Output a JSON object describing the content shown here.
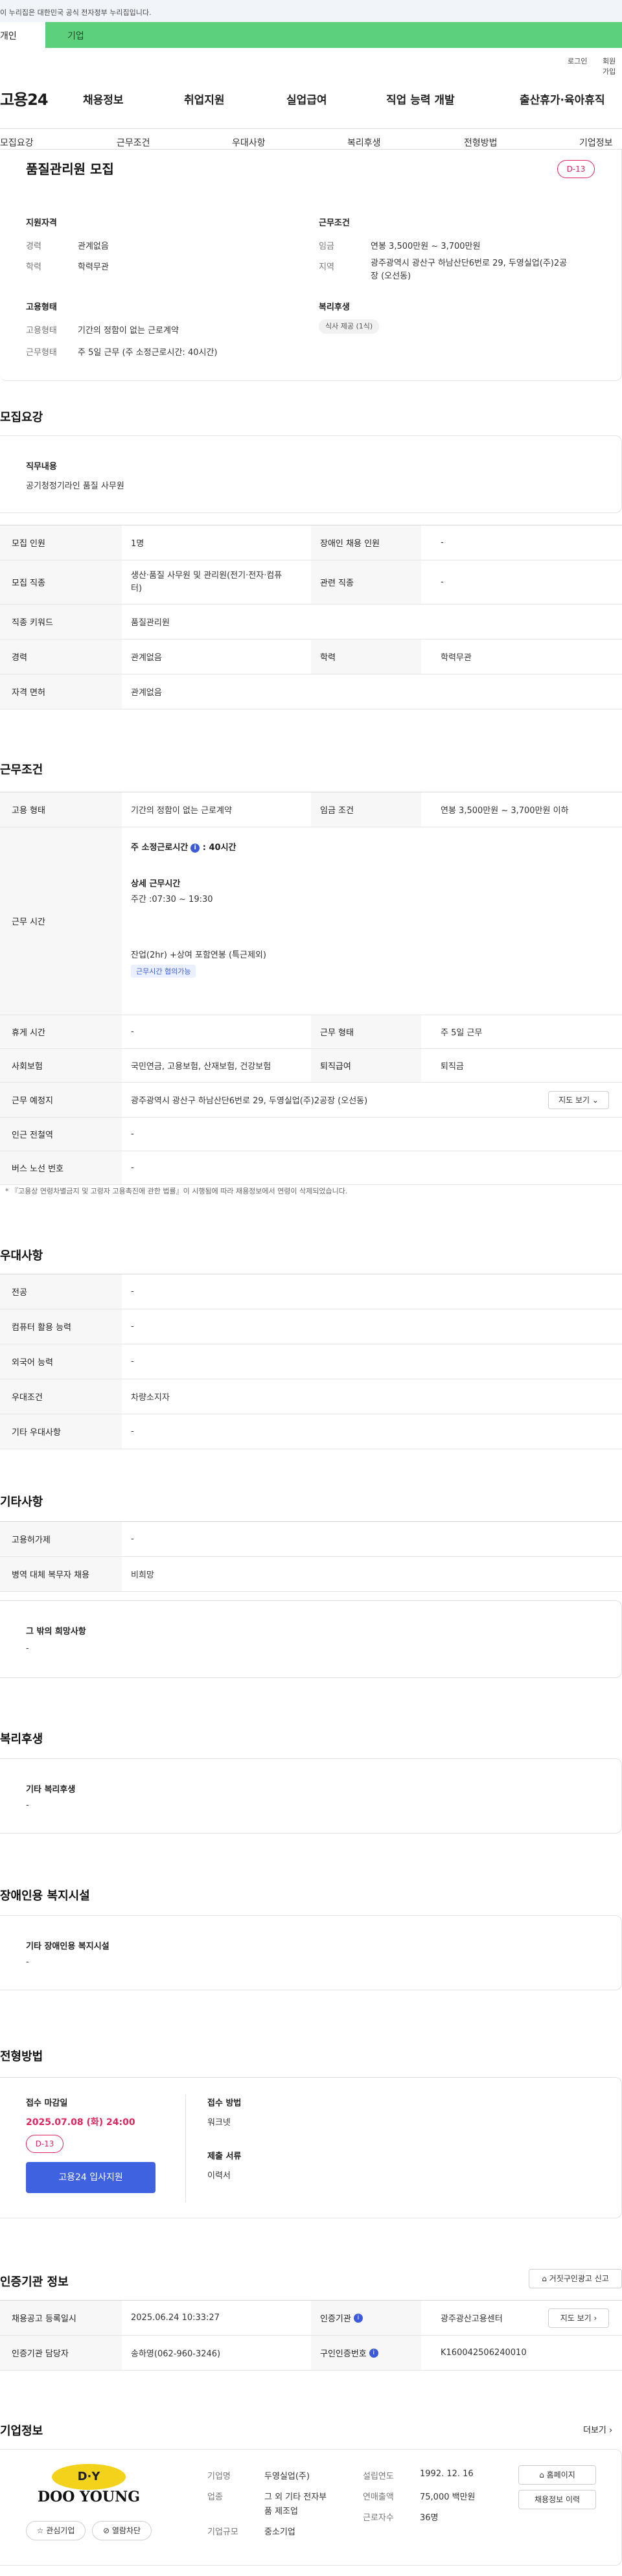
{
  "gov_banner": "이 누리집은 대한민국 공식 전자정부 누리집입니다.",
  "user_tabs": [
    "개인",
    "기업"
  ],
  "util": [
    "로그인",
    "회원가입"
  ],
  "logo": "고용24",
  "gnb": [
    "채용정보",
    "취업지원",
    "실업급여",
    "직업 능력 개발",
    "출산휴가·육아휴직"
  ],
  "tabs": [
    "모집요강",
    "근무조건",
    "우대사항",
    "복리후생",
    "전형방법",
    "기업정보"
  ],
  "job": {
    "title": "품질관리원 모집",
    "dday": "D-13",
    "req_title": "지원자격",
    "career_k": "경력",
    "career_v": "관계없음",
    "edu_k": "학력",
    "edu_v": "학력무관",
    "cond_title": "근무조건",
    "wage_k": "임금",
    "wage_v": "연봉 3,500만원 ~ 3,700만원",
    "region_k": "지역",
    "region_v1": "광주광역시 광산구 하남산단6번로 29, 두영실업(주)2공",
    "region_v2": "장 (오선동)",
    "emp_title": "고용형태",
    "emp_k": "고용형태",
    "emp_v": "기간의 정함이 없는 근로계약",
    "work_k": "근무형태",
    "work_v": "주 5일 근무 (주 소정근로시간: 40시간)",
    "welfare_title": "복리후생",
    "welfare_pill": "식사 제공 (1식)"
  },
  "recruit": {
    "title": "모집요강",
    "duty_title": "직무내용",
    "duty_text": "공기청정기라인 품질 사무원",
    "r1k": "모집 인원",
    "r1v": "1명",
    "r1k2": "장애인 채용 인원",
    "r1v2": "-",
    "r2k": "모집 직종",
    "r2v1": "생산·품질 사무원 및 관리원(전기·전자·컴퓨",
    "r2v2": "터)",
    "r2k2": "관련 직종",
    "r2v2b": "-",
    "r3k": "직종 키워드",
    "r3v": "품질관리원",
    "r4k": "경력",
    "r4v": "관계없음",
    "r4k2": "학력",
    "r4v2": "학력무관",
    "r5k": "자격 면허",
    "r5v": "관계없음"
  },
  "cond": {
    "title": "근무조건",
    "c1k": "고용 형태",
    "c1v": "기간의 정함이 없는 근로계약",
    "c1k2": "임금 조건",
    "c1v2": "연봉 3,500만원 ~ 3,700만원 이하",
    "c2k": "근무 시간",
    "hours_label": "주 소정근로시간",
    "hours_val": ": 40시간",
    "detail_label": "상세 근무시간",
    "detail_val": "주간 :07:30 ~ 19:30",
    "overtime": "잔업(2hr) +상여 포함연봉 (특근제외)",
    "tag": "근무시간 협의가능",
    "c3k": "휴게 시간",
    "c3v": "-",
    "c3k2": "근무 형태",
    "c3v2": "주 5일 근무",
    "c4k": "사회보험",
    "c4v": "국민연금, 고용보험, 산재보험, 건강보험",
    "c4k2": "퇴직급여",
    "c4v2": "퇴직금",
    "c5k": "근무 예정지",
    "c5v": "광주광역시 광산구 하남산단6번로 29, 두영실업(주)2공장 (오선동)",
    "map_btn": "지도 보기",
    "c6k": "인근 전철역",
    "c6v": "-",
    "c7k": "버스 노선 번호",
    "c7v": "-",
    "note": "* 『고용상 연령차별금지 및 고령자 고용촉진에 관한 법률』이 시행됨에 따라 채용정보에서 연령이 삭제되었습니다."
  },
  "pref": {
    "title": "우대사항",
    "p1k": "전공",
    "p1v": "-",
    "p2k": "컴퓨터 활용 능력",
    "p2v": "-",
    "p3k": "외국어 능력",
    "p3v": "-",
    "p4k": "우대조건",
    "p4v": "차량소지자",
    "p5k": "기타 우대사항",
    "p5v": "-"
  },
  "etc": {
    "title": "기타사항",
    "e1k": "고용허가제",
    "e1v": "-",
    "e2k": "병역 대체 복무자 채용",
    "e2v": "비희망",
    "wish_title": "그 밖의 희망사항",
    "wish_v": "-"
  },
  "welfare": {
    "title": "복리후생",
    "box_title": "기타 복리후생",
    "box_v": "-"
  },
  "disability": {
    "title": "장애인용 복지시설",
    "box_title": "기타 장애인용 복지시설",
    "box_v": "-"
  },
  "selection": {
    "title": "전형방법",
    "deadline_label": "접수 마감일",
    "deadline": "2025.07.08 (화) 24:00",
    "dday": "D-13",
    "apply_btn": "고용24 입사지원",
    "method_label": "접수 방법",
    "method_v": "워크넷",
    "docs_label": "제출 서류",
    "docs_v": "이력서"
  },
  "cert": {
    "title": "인증기관 정보",
    "report_btn": "거짓구인광고 신고",
    "k1": "채용공고 등록일시",
    "v1": "2025.06.24 10:33:27",
    "k2": "인증기관",
    "v2": "광주광산고용센터",
    "map_btn": "지도 보기",
    "k3": "인증기관 담당자",
    "v3": "송하영(062-960-3246)",
    "k4": "구인인증번호",
    "v4": "K160042506240010"
  },
  "company": {
    "title": "기업정보",
    "more": "더보기",
    "logo_top": "D·Y",
    "logo_name": "DOO YOUNG",
    "fav_btn": "관심기업",
    "block_btn": "열람차단",
    "name_k": "기업명",
    "name_v": "두영실업(주)",
    "ind_k": "업종",
    "ind_v1": "그 외 기타 전자부",
    "ind_v2": "품 제조업",
    "size_k": "기업규모",
    "size_v": "중소기업",
    "est_k": "설립연도",
    "est_v": "1992. 12. 16",
    "sales_k": "연매출액",
    "sales_v": "75,000 백만원",
    "emp_k": "근로자수",
    "emp_v": "36명",
    "home_btn": "홈페이지",
    "history_btn": "채용정보 이력"
  },
  "colors": {
    "accent": "#3f63e0",
    "dday": "#e0245e",
    "usertab": "#5cd07a"
  }
}
